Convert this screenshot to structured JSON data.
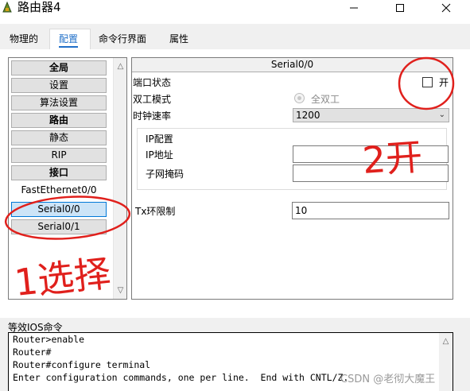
{
  "window": {
    "title": "路由器4"
  },
  "tabs": [
    {
      "label": "物理的",
      "active": false
    },
    {
      "label": "配置",
      "active": true
    },
    {
      "label": "命令行界面",
      "active": false
    },
    {
      "label": "属性",
      "active": false
    }
  ],
  "nav": {
    "items": [
      {
        "label": "全局",
        "style": "bold"
      },
      {
        "label": "设置",
        "style": "button"
      },
      {
        "label": "算法设置",
        "style": "button"
      },
      {
        "label": "路由",
        "style": "bold"
      },
      {
        "label": "静态",
        "style": "button"
      },
      {
        "label": "RIP",
        "style": "button"
      },
      {
        "label": "接口",
        "style": "bold"
      },
      {
        "label": "FastEthernet0/0",
        "style": "plain"
      },
      {
        "label": "Serial0/0",
        "style": "selected"
      },
      {
        "label": "Serial0/1",
        "style": "button"
      }
    ]
  },
  "panel": {
    "title": "Serial0/0",
    "port_status_label": "端口状态",
    "on_label": "开",
    "on_checked": false,
    "duplex_label": "双工模式",
    "full_duplex_label": "全双工",
    "clock_rate_label": "时钟速率",
    "clock_rate_value": "1200",
    "ip_config_label": "IP配置",
    "ip_address_label": "IP地址",
    "ip_address_value": "",
    "subnet_mask_label": "子网掩码",
    "subnet_mask_value": "",
    "tx_ring_label": "Tx环限制",
    "tx_ring_value": "10"
  },
  "ios": {
    "label": "等效IOS命令",
    "lines": [
      "",
      "Router>enable",
      "Router#",
      "Router#configure terminal",
      "Enter configuration commands, one per line.  End with CNTL/Z."
    ]
  },
  "annotations": {
    "step1": "1选择",
    "step2": "2开",
    "color": "#e0201c"
  },
  "watermark": "CSDN @老彻大魔王",
  "colors": {
    "accent": "#1f6fc8",
    "selected_bg": "#cce4f7"
  }
}
